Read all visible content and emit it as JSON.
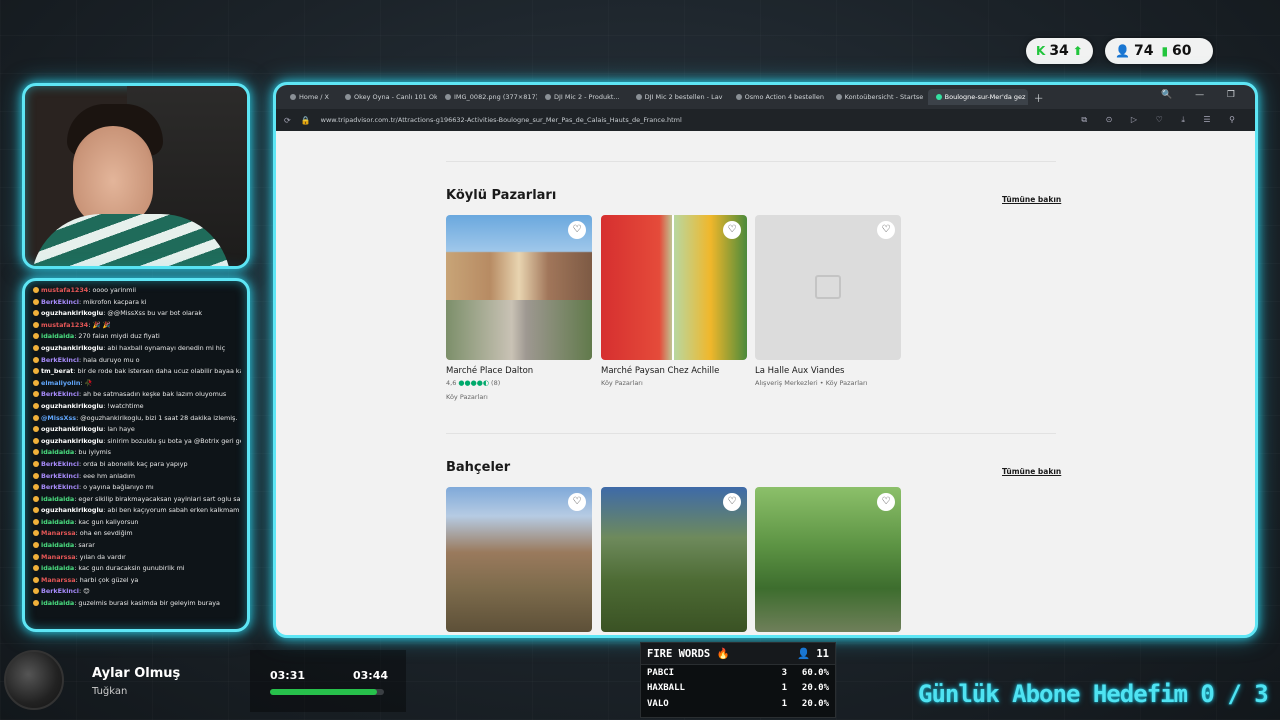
{
  "counters": {
    "first": {
      "value": "34",
      "icons": [
        "k-icon",
        "arrow-up-icon"
      ]
    },
    "second": {
      "value": "74",
      "icons": [
        "person-icon"
      ]
    },
    "third": {
      "value": "60",
      "icons": [
        "bars-icon"
      ]
    }
  },
  "browser": {
    "tabs": [
      {
        "label": "Home / X",
        "active": false
      },
      {
        "label": "Okey Oyna - Canlı 101 Ok",
        "active": false
      },
      {
        "label": "IMG_0082.png (377×817)",
        "active": false
      },
      {
        "label": "DJI Mic 2 - Produkt...",
        "active": false
      },
      {
        "label": "DJI Mic 2 bestellen - Lav",
        "active": false
      },
      {
        "label": "Osmo Action 4 bestellen",
        "active": false
      },
      {
        "label": "Kontoübersicht - Startse",
        "active": false
      },
      {
        "label": "Boulogne-sur-Mer'da gez",
        "active": true
      }
    ],
    "url": "www.tripadvisor.com.tr/Attractions-g196632-Activities-Boulogne_sur_Mer_Pas_de_Calais_Hauts_de_France.html"
  },
  "sections": [
    {
      "title": "Köylü Pazarları",
      "see_all": "Tümüne bakın",
      "cards": [
        {
          "name": "Marché Place Dalton",
          "rating": "4,6",
          "reviews": "(8)",
          "category": "Köy Pazarları",
          "image": "market"
        },
        {
          "name": "Marché Paysan Chez Achille",
          "rating": "",
          "reviews": "",
          "category": "Köy Pazarları",
          "image": "veg"
        },
        {
          "name": "La Halle Aux Viandes",
          "rating": "",
          "reviews": "",
          "category": "Alışveriş Merkezleri • Köy Pazarları",
          "image": "placeholder"
        }
      ]
    },
    {
      "title": "Bahçeler",
      "see_all": "Tümüne bakın",
      "cards": [
        {
          "name": "",
          "image": "garden1"
        },
        {
          "name": "",
          "image": "garden2"
        },
        {
          "name": "",
          "image": "garden3"
        }
      ]
    }
  ],
  "chat": [
    {
      "user": "mustafa1234",
      "text": "oooo yarinmii",
      "color": "#e45656"
    },
    {
      "user": "BerkEkinci",
      "text": "mikrofon kacpara ki",
      "color": "#a78bfa"
    },
    {
      "user": "oguzhankirikoglu",
      "text": "@@MissXss bu var bot olarak",
      "color": "#ffffff"
    },
    {
      "user": "mustafa1234",
      "text": "🎉 🎉",
      "color": "#e45656"
    },
    {
      "user": "idaidaida",
      "text": "270 falan miydi duz fiyati",
      "color": "#4ade80"
    },
    {
      "user": "oguzhankirikoglu",
      "text": "abi haxball oynamayı denedin mi hiç",
      "color": "#ffffff"
    },
    {
      "user": "BerkEkinci",
      "text": "hala duruyo mu o",
      "color": "#a78bfa"
    },
    {
      "user": "tm_berat",
      "text": "bir de rode bak istersen daha ucuz olabilir bayaa kaliteliler",
      "color": "#ffffff"
    },
    {
      "user": "elmaliyolin",
      "text": "🥀",
      "color": "#60a5fa"
    },
    {
      "user": "BerkEkinci",
      "text": "ah be satmasadın keşke bak lazım oluyomus",
      "color": "#a78bfa"
    },
    {
      "user": "oguzhankirikoglu",
      "text": "!watchtime",
      "color": "#ffffff"
    },
    {
      "user": "@MissXss",
      "text": "@oguzhankirikoglu, bizi 1 saat 28 dakika izlemiş.",
      "color": "#60a5fa"
    },
    {
      "user": "oguzhankirikoglu",
      "text": "lan haye",
      "color": "#ffffff"
    },
    {
      "user": "oguzhankirikoglu",
      "text": "sinirim bozuldu şu bota ya @Botrix geri gelsin",
      "color": "#ffffff"
    },
    {
      "user": "idaidaida",
      "text": "bu iyiymis",
      "color": "#4ade80"
    },
    {
      "user": "BerkEkinci",
      "text": "orda bi abonelik kaç para yapıyp",
      "color": "#a78bfa"
    },
    {
      "user": "BerkEkinci",
      "text": "eee hm anladım",
      "color": "#a78bfa"
    },
    {
      "user": "BerkEkinci",
      "text": "o yayına bağlanıyo mı",
      "color": "#a78bfa"
    },
    {
      "user": "idaidaida",
      "text": "eger sikilip birakmayacaksan yayinlari sart oglu sart",
      "color": "#4ade80"
    },
    {
      "user": "oguzhankirikoglu",
      "text": "abi ben kaçıyorum sabah erken kalkmam lazım görüşürüz",
      "color": "#ffffff"
    },
    {
      "user": "idaidaida",
      "text": "kac gun kaliyorsun",
      "color": "#4ade80"
    },
    {
      "user": "Manarssa",
      "text": "oha en sevdiğim",
      "color": "#e45656"
    },
    {
      "user": "idaidaida",
      "text": "sarar",
      "color": "#4ade80"
    },
    {
      "user": "Manarssa",
      "text": "yılan da vardır",
      "color": "#e45656"
    },
    {
      "user": "idaidaida",
      "text": "kac gun duracaksin gunubirlik mi",
      "color": "#4ade80"
    },
    {
      "user": "Manarssa",
      "text": "harbi çok güzel ya",
      "color": "#e45656"
    },
    {
      "user": "BerkEkinci",
      "text": "😊",
      "color": "#a78bfa"
    },
    {
      "user": "idaidaida",
      "text": "guzelmis burasi kasimda bir geleyim buraya",
      "color": "#4ade80"
    }
  ],
  "now_playing": {
    "title": "Aylar Olmuş",
    "artist": "Tuğkan",
    "elapsed": "03:31",
    "total": "03:44",
    "progress": 0.94
  },
  "fire_words": {
    "title": "FIRE WORDS 🔥",
    "count": "11",
    "rows": [
      {
        "word": "PABCI",
        "count": "3",
        "pct": "60.0%"
      },
      {
        "word": "HAXBALL",
        "count": "1",
        "pct": "20.0%"
      },
      {
        "word": "VALO",
        "count": "1",
        "pct": "20.0%"
      }
    ]
  },
  "sub_goal": "Günlük Abone Hedefim  0 / 3",
  "colors": {
    "accent": "#5ee6f5",
    "tripadvisor_green": "#00aa6c",
    "progress_green": "#27c04b"
  }
}
